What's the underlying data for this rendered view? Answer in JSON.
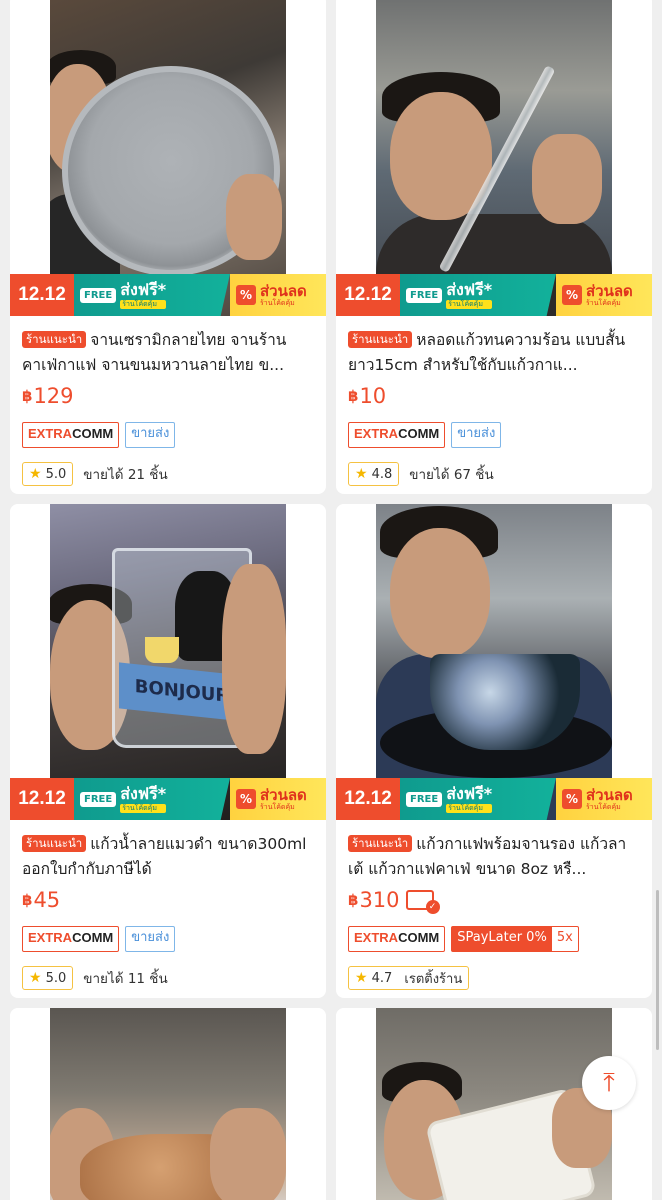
{
  "banner": {
    "date": "12.12",
    "free": "FREE",
    "shipping": "ส่งฟรี*",
    "shipping_sub": "ร้านโค้ดคุ้ม",
    "discount_icon": "%",
    "discount": "ส่วนลด",
    "discount_sub": "ร้านโค้ดคุ้ม"
  },
  "products": [
    {
      "recommended": "ร้านแนะนำ",
      "title": "จานเซรามิกลายไทย จานร้านคาเฟ่กาแฟ จานขนมหวานลายไทย ข...",
      "currency": "฿",
      "price": "129",
      "tag_extra_a": "EXTRA",
      "tag_extra_b": "COMM",
      "tag_wholesale": "ขายส่ง",
      "rating": "5.0",
      "sold": "ขายได้ 21 ชิ้น"
    },
    {
      "recommended": "ร้านแนะนำ",
      "title": "หลอดแก้วทนความร้อน แบบสั้น ยาว15cm สำหรับใช้กับแก้วกาแ...",
      "currency": "฿",
      "price": "10",
      "tag_extra_a": "EXTRA",
      "tag_extra_b": "COMM",
      "tag_wholesale": "ขายส่ง",
      "rating": "4.8",
      "sold": "ขายได้ 67 ชิ้น"
    },
    {
      "recommended": "ร้านแนะนำ",
      "title": "แก้วน้ำลายแมวดำ ขนาด300ml ออกใบกำกับภาษีได้",
      "currency": "฿",
      "price": "45",
      "tag_extra_a": "EXTRA",
      "tag_extra_b": "COMM",
      "tag_wholesale": "ขายส่ง",
      "rating": "5.0",
      "sold": "ขายได้ 11 ชิ้น",
      "glass_text": "BONJOUR"
    },
    {
      "recommended": "ร้านแนะนำ",
      "title": "แก้วกาแฟพร้อมจานรอง แก้วลาเต้ แก้วกาแฟคาเฟ่ ขนาด 8oz หรื...",
      "currency": "฿",
      "price": "310",
      "tag_extra_a": "EXTRA",
      "tag_extra_b": "COMM",
      "spaylater": "SPayLater 0%",
      "spaylater_x": "5x",
      "rating": "4.7",
      "sold": "เรตติ้งร้าน"
    }
  ],
  "icons": {
    "star": "★",
    "back_to_top": "⤒"
  },
  "colors": {
    "accent": "#ee4d2d",
    "shipping_teal": "#0f9b8e",
    "discount_yellow": "#ffd23f",
    "wholesale_blue": "#4a90d9"
  }
}
